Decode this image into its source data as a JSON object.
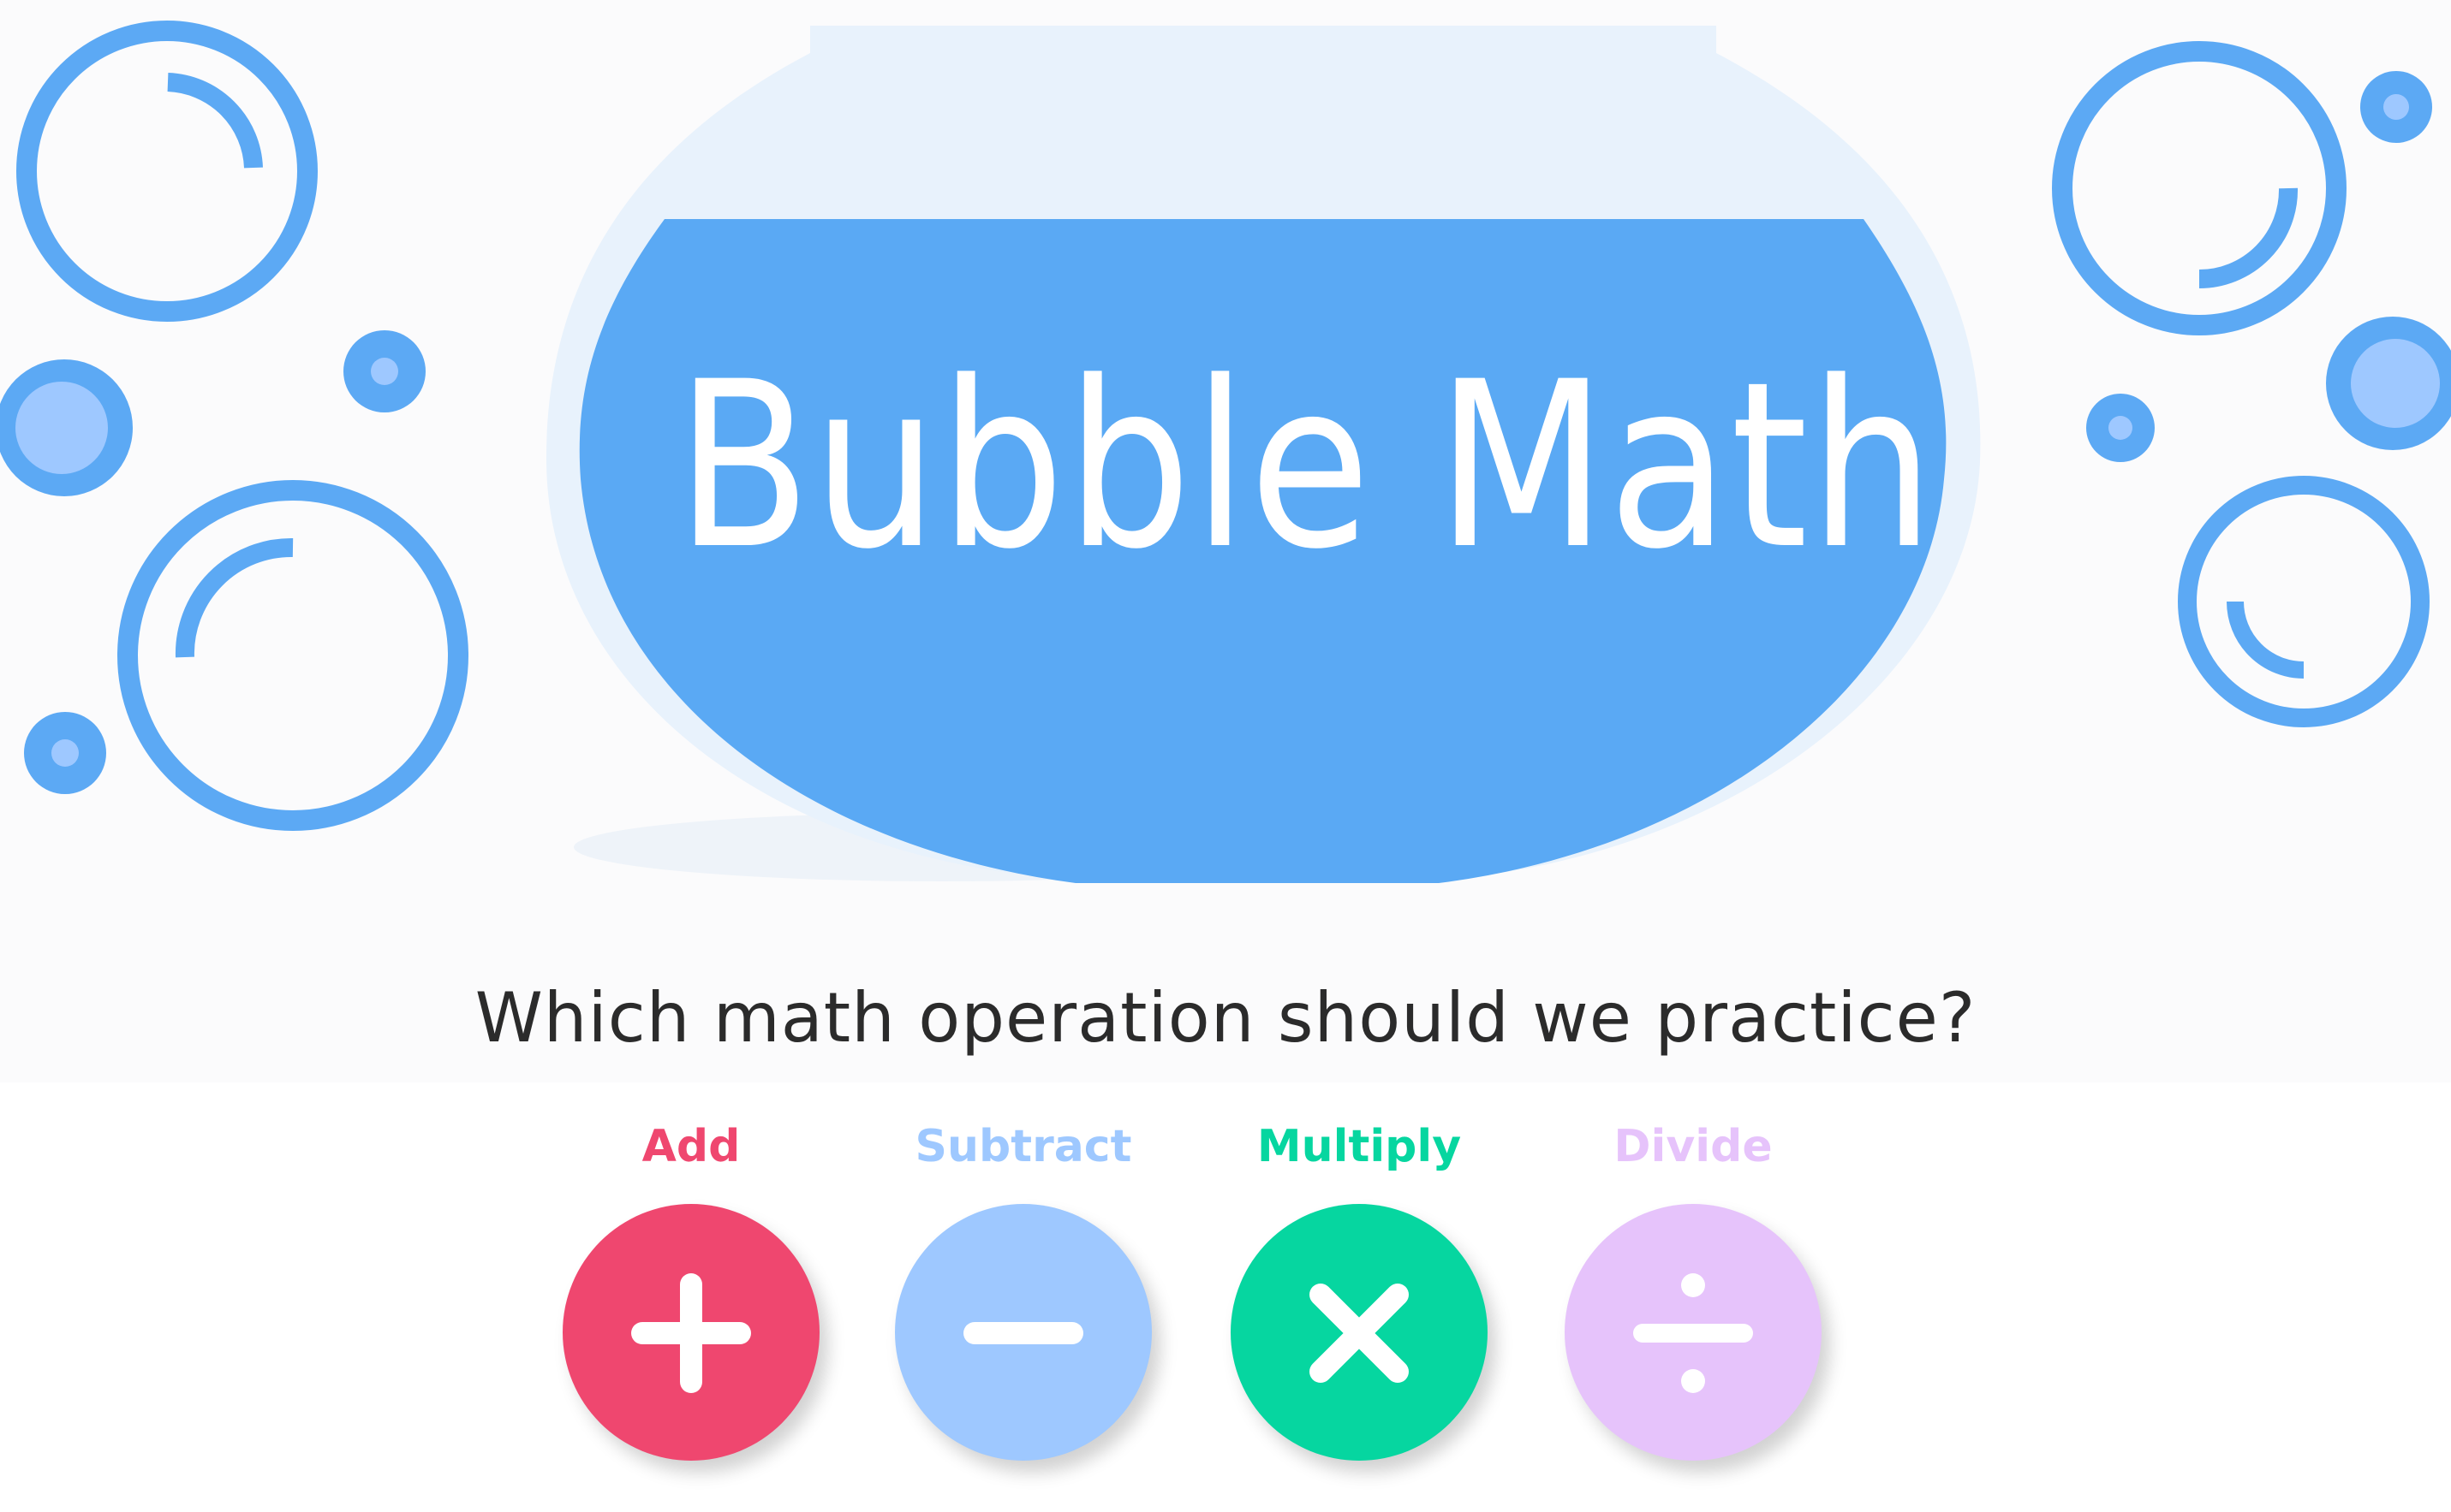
{
  "app": {
    "title": "Bubble Math"
  },
  "prompt": {
    "question": "Which math operation should we practice?"
  },
  "operations": [
    {
      "label": "Add",
      "icon": "plus-icon",
      "color": "#ef476f"
    },
    {
      "label": "Subtract",
      "icon": "minus-icon",
      "color": "#9ec8ff"
    },
    {
      "label": "Multiply",
      "icon": "multiply-icon",
      "color": "#06d6a0"
    },
    {
      "label": "Divide",
      "icon": "divide-icon",
      "color": "#e6c3fb"
    }
  ],
  "theme": {
    "bubble": "#5ca9f4",
    "bowl_water": "#5aa9f4",
    "bowl_glass": "#e8f2fc"
  }
}
